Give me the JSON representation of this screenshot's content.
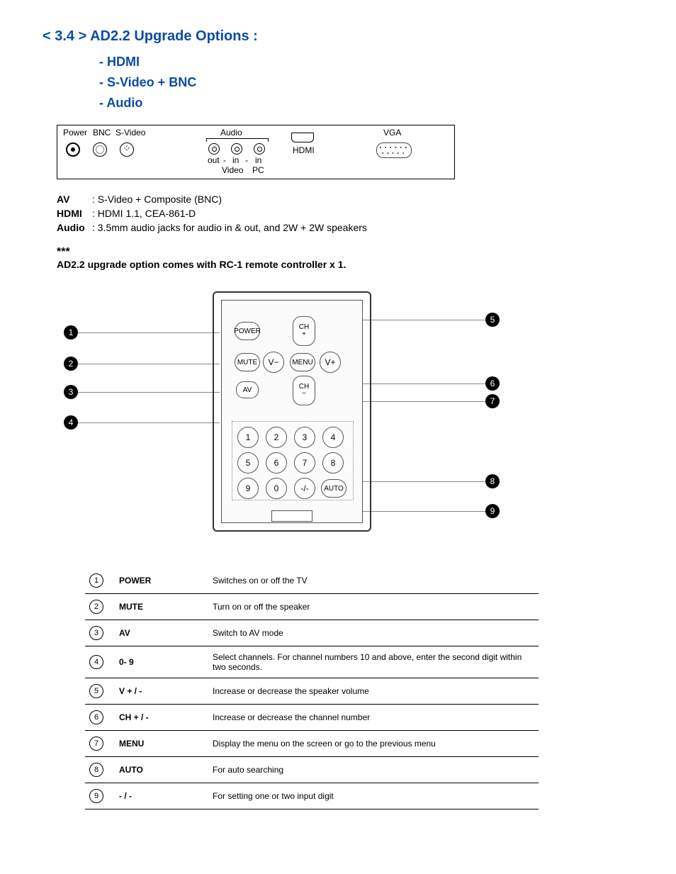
{
  "heading": {
    "main": "< 3.4 > AD2.2 Upgrade Options :",
    "subs": [
      "- HDMI",
      "- S-Video + BNC",
      "- Audio"
    ]
  },
  "panel": {
    "power": "Power",
    "bnc": "BNC",
    "svideo": "S-Video",
    "audio": "Audio",
    "out": "out",
    "dash1": "-",
    "in1": "in",
    "dash2": "-",
    "in2": "in",
    "video": "Video",
    "pc": "PC",
    "hdmi": "HDMI",
    "vga": "VGA"
  },
  "defs": {
    "av_k": "AV",
    "av_v": ": S-Video + Composite (BNC)",
    "hdmi_k": "HDMI",
    "hdmi_v": ": HDMI 1.1, CEA-861-D",
    "audio_k": "Audio",
    "audio_v": ": 3.5mm audio jacks for audio in & out, and 2W + 2W speakers"
  },
  "note": {
    "stars": "***",
    "line": "AD2.2 upgrade option comes with RC-1 remote controller x 1."
  },
  "remote": {
    "power": "POWER",
    "mute": "MUTE",
    "av": "AV",
    "menu": "MENU",
    "auto": "AUTO",
    "vminus": "V−",
    "vplus": "V+",
    "chplus_top": "CH",
    "chplus_bot": "+",
    "chminus_top": "CH",
    "chminus_bot": "−",
    "twodigit": "-/-",
    "nums": [
      "1",
      "2",
      "3",
      "4",
      "5",
      "6",
      "7",
      "8",
      "9",
      "0"
    ]
  },
  "callouts": [
    "1",
    "2",
    "3",
    "4",
    "5",
    "6",
    "7",
    "8",
    "9"
  ],
  "table": [
    {
      "n": "1",
      "k": "POWER",
      "d": "Switches on or off the TV"
    },
    {
      "n": "2",
      "k": "MUTE",
      "d": "Turn on or off the speaker"
    },
    {
      "n": "3",
      "k": "AV",
      "d": "Switch to AV mode"
    },
    {
      "n": "4",
      "k": "0- 9",
      "d": "Select channels. For channel numbers 10 and above, enter the second digit within two seconds."
    },
    {
      "n": "5",
      "k": "V + / -",
      "d": "Increase or decrease the speaker volume"
    },
    {
      "n": "6",
      "k": "CH + / -",
      "d": "Increase or decrease the channel number"
    },
    {
      "n": "7",
      "k": "MENU",
      "d": "Display the menu on the screen or go to the previous menu"
    },
    {
      "n": "8",
      "k": "AUTO",
      "d": "For auto searching"
    },
    {
      "n": "9",
      "k": "- / -",
      "d": "For setting one or two input digit"
    }
  ]
}
